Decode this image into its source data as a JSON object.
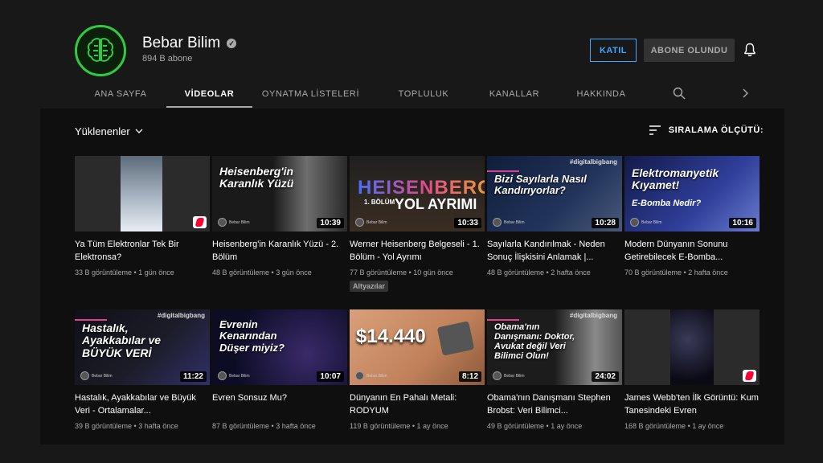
{
  "channel": {
    "name": "Bebar Bilim",
    "subscribers": "894 B abone",
    "join_label": "KATIL",
    "subscribed_label": "ABONE OLUNDU"
  },
  "tabs": [
    {
      "label": "ANA SAYFA"
    },
    {
      "label": "VİDEOLAR"
    },
    {
      "label": "OYNATMA LİSTELERİ"
    },
    {
      "label": "TOPLULUK"
    },
    {
      "label": "KANALLAR"
    },
    {
      "label": "HAKKINDA"
    }
  ],
  "filter": {
    "label": "Yüklenenler"
  },
  "sort": {
    "label": "SIRALAMA ÖLÇÜTÜ:"
  },
  "videos": [
    {
      "title": "Ya Tüm Elektronlar Tek Bir Elektronsa?",
      "views": "33 B görüntüleme",
      "age": "1 gün önce",
      "duration": "",
      "thumb_text": "",
      "tag": "",
      "short": true
    },
    {
      "title": "Heisenberg'in Karanlık Yüzü - 2. Bölüm",
      "views": "48 B görüntüleme",
      "age": "3 gün önce",
      "duration": "10:39",
      "thumb_text": "Heisenberg'in Karanlık Yüzü",
      "tag": "",
      "short": false
    },
    {
      "title": "Werner Heisenberg Belgeseli - 1. Bölüm - Yol Ayrımı",
      "views": "77 B görüntüleme",
      "age": "10 gün önce",
      "duration": "10:33",
      "thumb_text": "HEISENBERG",
      "thumb_sub": "1. BÖLÜM",
      "thumb_sub2": "YOL AYRIMI",
      "tag": "",
      "short": false,
      "badge": "Altyazılar"
    },
    {
      "title": "Sayılarla Kandırılmak - Neden Sonuç İlişkisini Anlamak |...",
      "views": "48 B görüntüleme",
      "age": "2 hafta önce",
      "duration": "10:28",
      "thumb_text": "Bizi Sayılarla Nasıl Kandırıyorlar?",
      "tag": "#digitalbigbang",
      "short": false
    },
    {
      "title": "Modern Dünyanın Sonunu Getirebilecek E-Bomba...",
      "views": "70 B görüntüleme",
      "age": "2 hafta önce",
      "duration": "10:16",
      "thumb_text": "Elektromanyetik Kıyamet!",
      "thumb_sub": "E-Bomba Nedir?",
      "tag": "",
      "short": false
    },
    {
      "title": "Hastalık, Ayakkabılar ve Büyük Veri - Ortalamalar...",
      "views": "39 B görüntüleme",
      "age": "3 hafta önce",
      "duration": "11:22",
      "thumb_text": "Hastalık, Ayakkabılar ve BÜYÜK VERİ",
      "tag": "#digitalbigbang",
      "short": false
    },
    {
      "title": "Evren Sonsuz Mu?",
      "views": "87 B görüntüleme",
      "age": "3 hafta önce",
      "duration": "10:07",
      "thumb_text": "Evrenin Kenarından Düşer miyiz?",
      "tag": "",
      "short": false
    },
    {
      "title": "Dünyanın En Pahalı Metali: RODYUM",
      "views": "119 B görüntüleme",
      "age": "1 ay önce",
      "duration": "8:12",
      "thumb_text": "$14.440",
      "tag": "",
      "short": false
    },
    {
      "title": "Obama'nın Danışmanı Stephen Brobst: Veri Bilimci...",
      "views": "49 B görüntüleme",
      "age": "1 ay önce",
      "duration": "24:02",
      "thumb_text": "Obama'nın Danışmanı: Doktor, Avukat değil Veri Bilimci Olun!",
      "tag": "#digitalbigbang",
      "short": false
    },
    {
      "title": "James Webb'ten İlk Görüntü: Kum Tanesindeki Evren",
      "views": "168 B görüntüleme",
      "age": "1 ay önce",
      "duration": "",
      "thumb_text": "",
      "tag": "",
      "short": true
    }
  ],
  "brand_label": "Bebar Bilim",
  "colors": {
    "accent": "#3ea6ff",
    "avatar_ring": "#2ecc40",
    "shorts": "#ff0033"
  }
}
